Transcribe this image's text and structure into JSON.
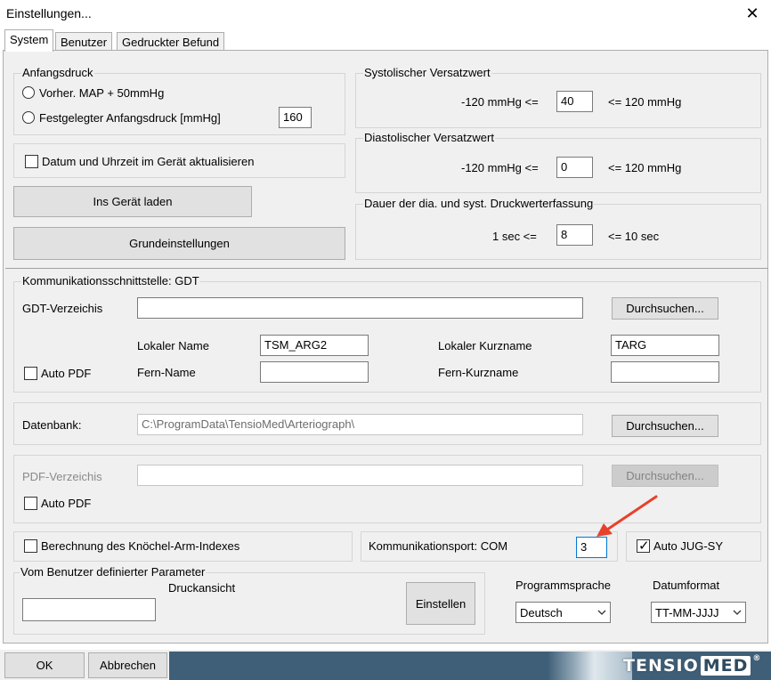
{
  "window": {
    "title": "Einstellungen..."
  },
  "tabs": [
    "System",
    "Benutzer",
    "Gedruckter Befund"
  ],
  "anfangsdruck": {
    "legend": "Anfangsdruck",
    "option1": "Vorher. MAP + 50mmHg",
    "option2": "Festgelegter Anfangsdruck [mmHg]",
    "value": "160"
  },
  "datum": {
    "label": "Datum und Uhrzeit im Gerät aktualisieren",
    "checked": false
  },
  "buttons": {
    "ins_geraet": "Ins Gerät laden",
    "grundeinstellungen": "Grundeinstellungen"
  },
  "systolisch": {
    "legend": "Systolischer Versatzwert",
    "min": "-120 mmHg <=",
    "value": "40",
    "max": "<= 120 mmHg"
  },
  "diastolisch": {
    "legend": "Diastolischer Versatzwert",
    "min": "-120 mmHg <=",
    "value": "0",
    "max": "<= 120 mmHg"
  },
  "dauer": {
    "legend": "Dauer der dia. und syst. Druckwerterfassung",
    "min": "1 sec <=",
    "value": "8",
    "max": "<= 10 sec"
  },
  "gdt": {
    "legend": "Kommunikationsschnittstelle: GDT",
    "verzeichnis_label": "GDT-Verzeichis",
    "verzeichnis_value": "",
    "browse": "Durchsuchen...",
    "lokaler_name_label": "Lokaler Name",
    "lokaler_name_value": "TSM_ARG2",
    "fern_name_label": "Fern-Name",
    "fern_name_value": "",
    "lokaler_kurzname_label": "Lokaler Kurzname",
    "lokaler_kurzname_value": "TARG",
    "fern_kurzname_label": "Fern-Kurzname",
    "fern_kurzname_value": "",
    "auto_pdf": "Auto PDF"
  },
  "datenbank": {
    "label": "Datenbank:",
    "value": "C:\\ProgramData\\TensioMed\\Arteriograph\\",
    "browse": "Durchsuchen..."
  },
  "pdf": {
    "label": "PDF-Verzeichis",
    "value": "",
    "browse": "Durchsuchen...",
    "auto_pdf": "Auto PDF"
  },
  "abi": {
    "label": "Berechnung des Knöchel-Arm-Indexes"
  },
  "komport": {
    "label": "Kommunikationsport: COM",
    "value": "3"
  },
  "autojug": {
    "label": "Auto JUG-SY",
    "checked": true
  },
  "benutzer_param": {
    "legend": "Vom Benutzer definierter Parameter",
    "druckansicht": "Druckansicht",
    "value": "",
    "einstellen": "Einstellen"
  },
  "sprache": {
    "label": "Programmsprache",
    "value": "Deutsch"
  },
  "datumformat": {
    "label": "Datumformat",
    "value": "TT-MM-JJJJ"
  },
  "footer": {
    "ok": "OK",
    "abbrechen": "Abbrechen"
  },
  "brand": {
    "part1": "TENSIO",
    "part2": "MED",
    "reg": "®"
  },
  "colors": {
    "annotation_arrow": "#e8412b",
    "focus_border": "#0078d7",
    "brand_bar": "#3f5f78"
  }
}
